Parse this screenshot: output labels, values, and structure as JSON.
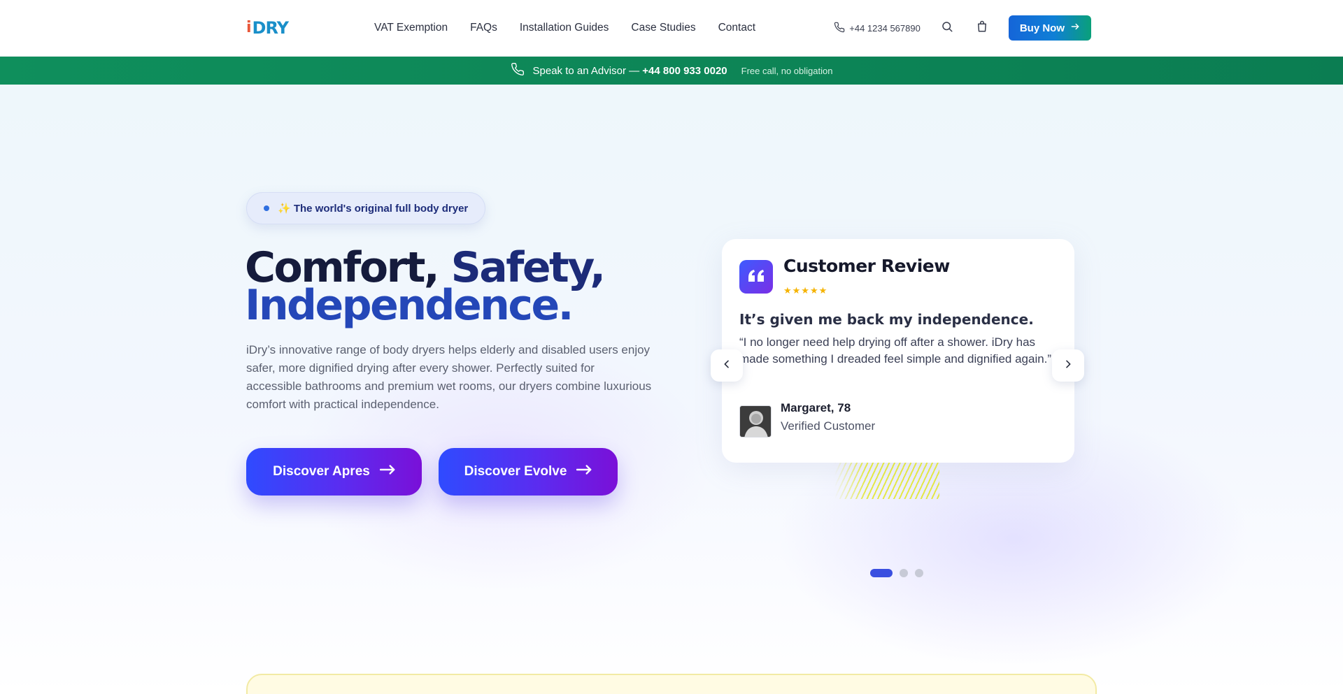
{
  "header": {
    "logo_i": "i",
    "logo_text": "DRY",
    "nav": [
      "VAT Exemption",
      "FAQs",
      "Installation Guides",
      "Case Studies",
      "Contact"
    ],
    "phone": "+44 1234 567890",
    "buy_label": "Buy Now"
  },
  "advisor": {
    "label": "Speak to an Advisor —",
    "number": "+44 800 933 0020",
    "sub": "Free call, no obligation"
  },
  "hero": {
    "pill": "✨ The world's original full body dryer",
    "headline_1": "Comfort,",
    "headline_2": "Safety,",
    "headline_3": "Independence.",
    "description": "iDry’s innovative range of body dryers helps elderly and disabled users enjoy safer, more dignified drying after every shower. Perfectly suited for accessible bathrooms and premium wet rooms, our dryers combine luxurious comfort with practical independence.",
    "cta_1": "Discover Apres",
    "cta_2": "Discover Evolve"
  },
  "review": {
    "title": "Customer Review",
    "stars": "★★★★★",
    "rating": 5,
    "headline": "It’s given me back my independence.",
    "quote": "“I no longer need help drying off after a shower. iDry has made something I dreaded feel simple and dignified again.”",
    "name": "Margaret, 78",
    "role": "Verified Customer",
    "slide_count": 3,
    "active_slide": 1
  },
  "colors": {
    "brand_blue": "#1a8fc9",
    "green_bar": "#0f8f5c",
    "cta_gradient_start": "#2f4bff",
    "cta_gradient_end": "#7a10d8",
    "star": "#f5b301"
  }
}
